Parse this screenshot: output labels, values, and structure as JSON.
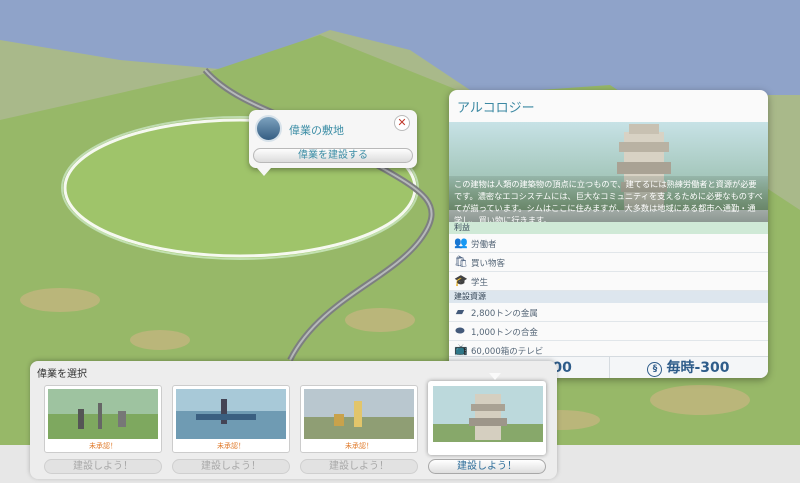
{
  "site_popup": {
    "title": "偉業の敷地",
    "build_label": "偉業を建設する",
    "close_glyph": "✕"
  },
  "info_panel": {
    "title": "アルコロジー",
    "description": "この建物は人類の建築物の頂点に立つもので、建てるには熟練労働者と資源が必要です。濃密なエコシステムには、巨大なコミュニティを支えるために必要なものすべてが揃っています。シムはここに住みますが、大多数は地域にある都市へ通勤・通学し、買い物に行きます。",
    "benefits_header": "利益",
    "benefits": [
      {
        "icon": "workers-icon",
        "label": "労働者"
      },
      {
        "icon": "shoppers-icon",
        "label": "買い物客"
      },
      {
        "icon": "students-icon",
        "label": "学生"
      }
    ],
    "resources_header": "建設資源",
    "resources": [
      {
        "icon": "metal-icon",
        "label": "2,800トンの金属"
      },
      {
        "icon": "alloy-icon",
        "label": "1,000トンの合金"
      },
      {
        "icon": "tv-icon",
        "label": "60,000箱のテレビ"
      }
    ],
    "cost": "1,000,000",
    "upkeep": "毎時-300",
    "currency_symbol": "§"
  },
  "selector": {
    "title": "偉業を選択",
    "cards": [
      {
        "status": "未承認！",
        "button": "建設しよう！",
        "enabled": false
      },
      {
        "status": "未承認！",
        "button": "建設しよう！",
        "enabled": false
      },
      {
        "status": "未承認！",
        "button": "建設しよう！",
        "enabled": false
      },
      {
        "status": "",
        "button": "建設しよう！",
        "enabled": true
      }
    ]
  },
  "colors": {
    "sky": "#8fa3c9",
    "grass": "#8fb35a",
    "accent_text": "#3b88a2",
    "money": "#2e5c8a",
    "unbuilt": "#e07a2a"
  }
}
